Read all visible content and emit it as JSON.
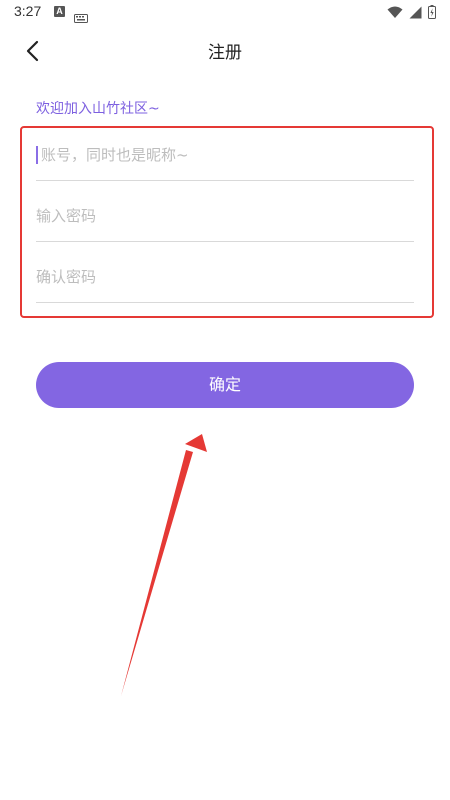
{
  "status_bar": {
    "time": "3:27",
    "a_badge": "A",
    "icons": [
      "notification-a-icon",
      "keyboard-icon",
      "wifi-icon",
      "signal-icon",
      "battery-icon"
    ]
  },
  "header": {
    "title": "注册",
    "back_icon": "chevron-left-icon"
  },
  "form": {
    "welcome": "欢迎加入山竹社区~",
    "account_placeholder": "账号，同时也是昵称~",
    "password_placeholder": "输入密码",
    "confirm_placeholder": "确认密码",
    "account_value": "",
    "password_value": "",
    "confirm_value": ""
  },
  "actions": {
    "confirm_label": "确定"
  },
  "colors": {
    "accent": "#8366e2",
    "welcome_text": "#7d60e0",
    "annotation_red": "#e53935"
  }
}
